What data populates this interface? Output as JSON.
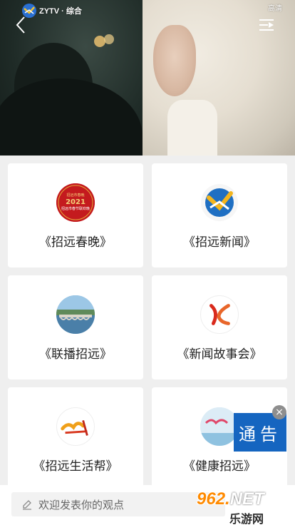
{
  "video": {
    "channel_logo_text": "ZYTV · 综合",
    "quality_label": "高清",
    "back_icon": "chevron-left-icon",
    "playlist_icon": "playlist-icon"
  },
  "programs": [
    {
      "label": "《招远春晚》",
      "icon": "spring-gala-icon",
      "badge_lines": [
        "招远市春晚",
        "2021",
        "招远市春节联欢晚"
      ]
    },
    {
      "label": "《招远新闻》",
      "icon": "news-logo-icon"
    },
    {
      "label": "《联播招远》",
      "icon": "bridge-photo-icon"
    },
    {
      "label": "《新闻故事会》",
      "icon": "story-logo-icon"
    },
    {
      "label": "《招远生活帮》",
      "icon": "life-help-icon"
    },
    {
      "label": "《健康招远》",
      "icon": "health-icon"
    }
  ],
  "notice": {
    "label": "通告",
    "close_label": "×"
  },
  "comment": {
    "placeholder": "欢迎发表你的观点",
    "icon": "pencil-icon"
  },
  "watermark": {
    "top": "962.",
    "net": "NET",
    "bottom": "乐游网"
  },
  "colors": {
    "page_bg": "#efefef",
    "card_bg": "#ffffff",
    "notice_bg": "#1565c0",
    "text": "#222222"
  }
}
